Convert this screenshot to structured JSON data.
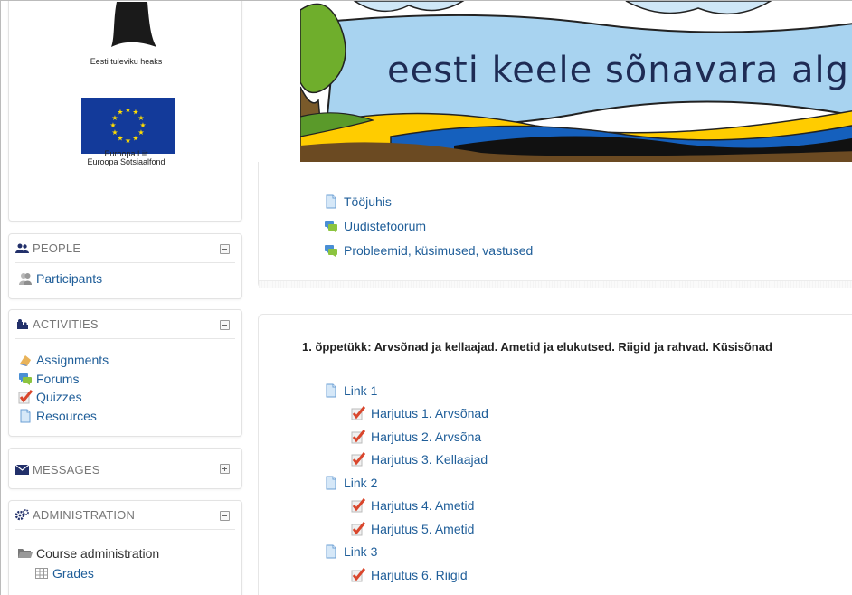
{
  "sidebar": {
    "logos": {
      "estonian_caption": "Eesti tuleviku heaks",
      "eu_caption_line1": "Euroopa Liit",
      "eu_caption_line2": "Euroopa Sotsiaalfond"
    },
    "people": {
      "title": "PEOPLE",
      "items": [
        {
          "label": "Participants",
          "icon": "participants-icon"
        }
      ]
    },
    "activities": {
      "title": "ACTIVITIES",
      "items": [
        {
          "label": "Assignments",
          "icon": "assignment-icon"
        },
        {
          "label": "Forums",
          "icon": "forum-icon"
        },
        {
          "label": "Quizzes",
          "icon": "quiz-icon"
        },
        {
          "label": "Resources",
          "icon": "resource-icon"
        }
      ]
    },
    "messages": {
      "title": "MESSAGES"
    },
    "administration": {
      "title": "ADMINISTRATION",
      "items": [
        {
          "label": "Course administration",
          "icon": "folder-icon"
        },
        {
          "label": "Grades",
          "icon": "grades-icon"
        }
      ]
    }
  },
  "banner": {
    "title": "eesti keele sõnavara algkursus"
  },
  "top_section": {
    "items": [
      {
        "label": "Tööjuhis",
        "icon": "resource-icon"
      },
      {
        "label": "Uudistefoorum",
        "icon": "forum-icon"
      },
      {
        "label": "Probleemid, küsimused, vastused",
        "icon": "forum-icon"
      }
    ]
  },
  "lesson": {
    "title": "1. õppetükk: Arvsõnad ja kellaajad. Ametid ja elukutsed. Riigid ja rahvad. Küsisõnad",
    "items": [
      {
        "label": "Link 1",
        "type": "resource"
      },
      {
        "label": "Harjutus 1. Arvsõnad",
        "type": "quiz"
      },
      {
        "label": "Harjutus 2. Arvsõna",
        "type": "quiz"
      },
      {
        "label": "Harjutus 3. Kellaajad",
        "type": "quiz"
      },
      {
        "label": "Link 2",
        "type": "resource"
      },
      {
        "label": "Harjutus 4. Ametid",
        "type": "quiz"
      },
      {
        "label": "Harjutus 5. Ametid",
        "type": "quiz"
      },
      {
        "label": "Link 3",
        "type": "resource"
      },
      {
        "label": "Harjutus 6. Riigid",
        "type": "quiz"
      }
    ]
  },
  "colors": {
    "link": "#1f5e99",
    "banner_text": "#1e2b54",
    "eu_blue": "#133a9a",
    "eu_star": "#ffdd00"
  }
}
